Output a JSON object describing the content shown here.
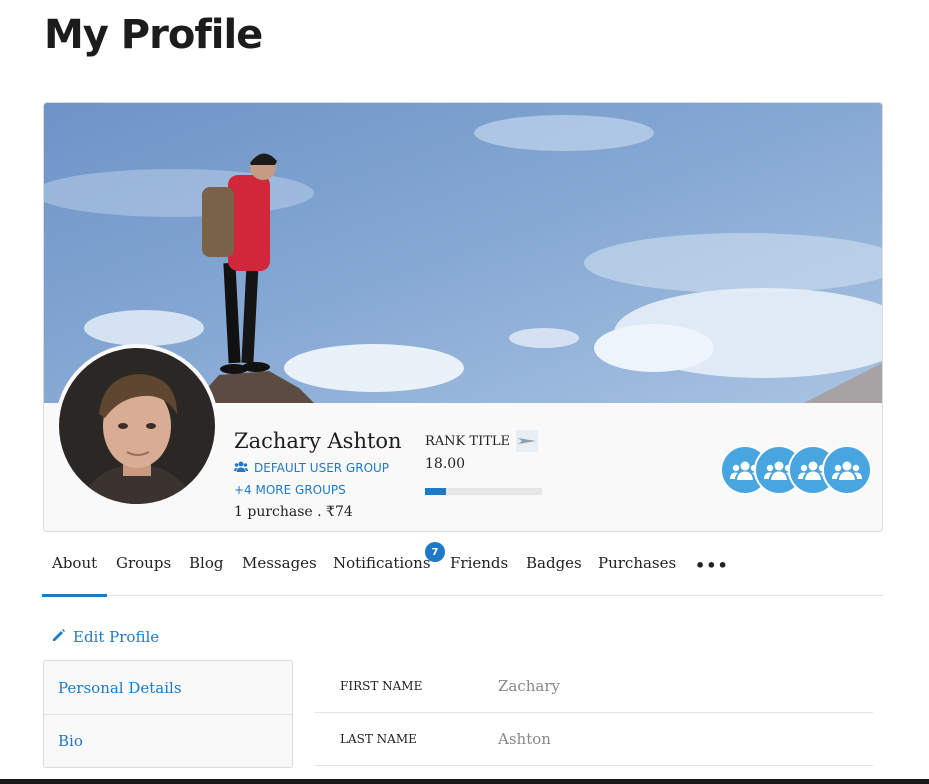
{
  "page": {
    "title": "My Profile"
  },
  "profile": {
    "name": "Zachary Ashton",
    "default_group": "DEFAULT USER GROUP",
    "more_groups": "+4 MORE GROUPS",
    "purchases": "1 purchase . ₹74",
    "rank_title": "RANK TITLE",
    "points": "18.00",
    "progress_fraction": 0.18,
    "group_icon_count": 4
  },
  "tabs": {
    "items": [
      {
        "label": "About"
      },
      {
        "label": "Groups"
      },
      {
        "label": "Blog"
      },
      {
        "label": "Messages"
      },
      {
        "label": "Notifications"
      },
      {
        "label": "Friends"
      },
      {
        "label": "Badges"
      },
      {
        "label": "Purchases"
      }
    ],
    "active": "About",
    "notification_count": "7"
  },
  "edit": {
    "label": "Edit Profile"
  },
  "sidebar": {
    "items": [
      {
        "label": "Personal Details"
      },
      {
        "label": "Bio"
      }
    ]
  },
  "details": {
    "rows": [
      {
        "label": "FIRST NAME",
        "value": "Zachary"
      },
      {
        "label": "LAST NAME",
        "value": "Ashton"
      }
    ]
  },
  "colors": {
    "accent": "#1f79c5",
    "group_icon_bg": "#49a5e0"
  },
  "icons": [
    "users-icon",
    "pencil-icon",
    "more-icon",
    "rank-badge-icon",
    "group-avatar-icon"
  ]
}
